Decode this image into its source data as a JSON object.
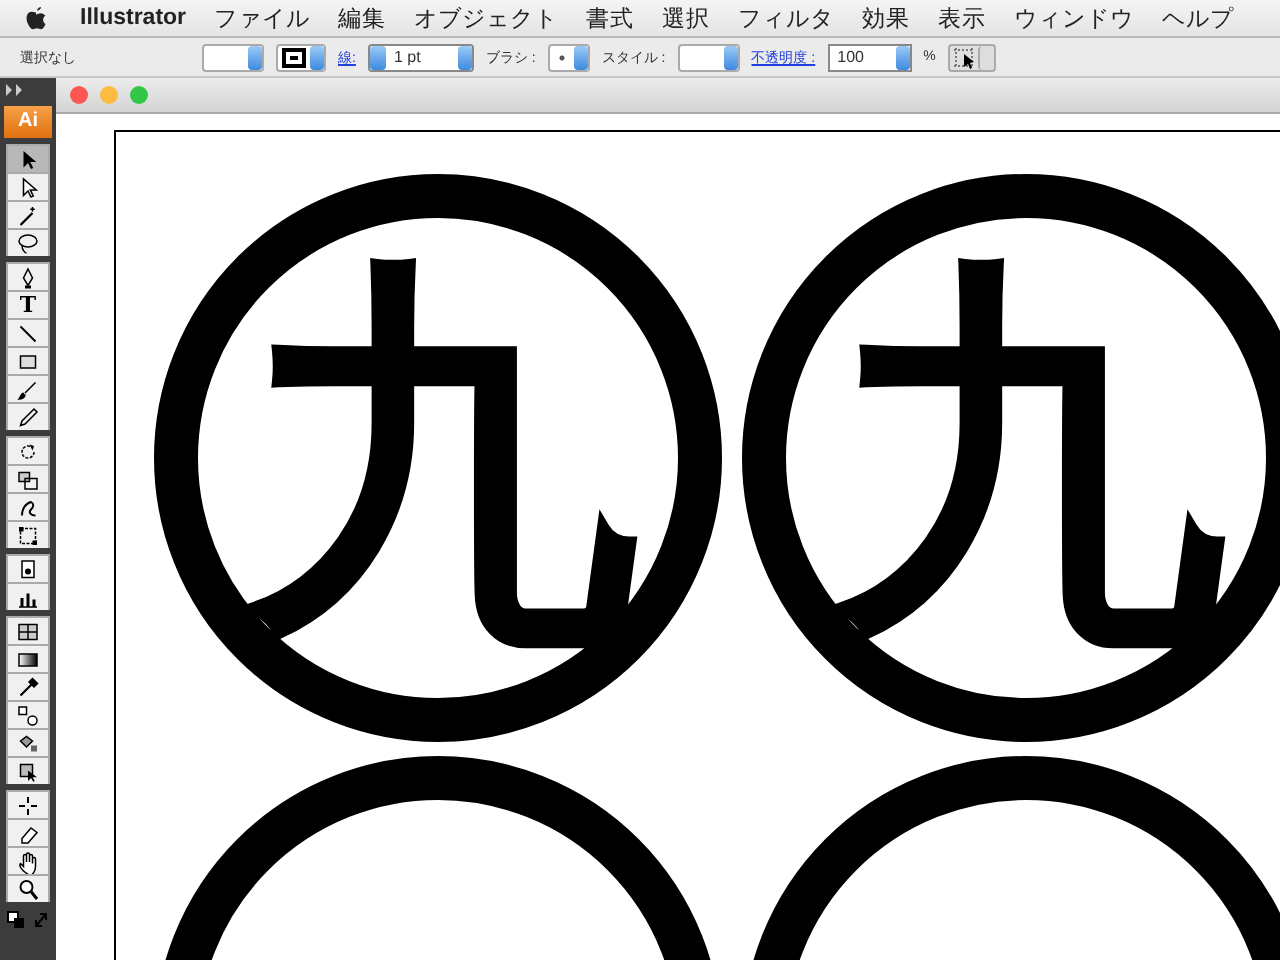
{
  "menu_bar": {
    "app": "Illustrator",
    "items": [
      "ファイル",
      "編集",
      "オブジェクト",
      "書式",
      "選択",
      "フィルタ",
      "効果",
      "表示",
      "ウィンドウ",
      "ヘルプ"
    ]
  },
  "control_bar": {
    "selection_status": "選択なし",
    "stroke_label": "線:",
    "stroke_weight": "1 pt",
    "brush_label": "ブラシ :",
    "style_label": "スタイル :",
    "opacity_label": "不透明度 :",
    "opacity": "100",
    "opacity_unit": "%"
  },
  "tools_panel": {
    "logo": "Ai",
    "tools": [
      {
        "kind": "selection",
        "selected": true
      },
      {
        "kind": "direct-selection",
        "selected": false
      },
      {
        "kind": "magic-wand",
        "selected": false
      },
      {
        "kind": "lasso",
        "selected": false
      },
      {
        "kind": "pen",
        "selected": false
      },
      {
        "kind": "type",
        "label": "T",
        "selected": false
      },
      {
        "kind": "line",
        "selected": false
      },
      {
        "kind": "rectangle",
        "selected": false
      },
      {
        "kind": "paintbrush",
        "selected": false
      },
      {
        "kind": "pencil",
        "selected": false
      },
      {
        "kind": "rotate",
        "selected": false
      },
      {
        "kind": "scale",
        "selected": false
      },
      {
        "kind": "warp",
        "selected": false
      },
      {
        "kind": "free-transform",
        "selected": false
      },
      {
        "kind": "symbol",
        "selected": false
      },
      {
        "kind": "graph",
        "selected": false
      },
      {
        "kind": "mesh",
        "selected": false
      },
      {
        "kind": "gradient",
        "selected": false
      },
      {
        "kind": "eyedropper",
        "selected": false
      },
      {
        "kind": "blend",
        "selected": false
      },
      {
        "kind": "live-paint",
        "selected": false
      },
      {
        "kind": "live-paint-select",
        "selected": false
      },
      {
        "kind": "slice",
        "selected": false
      },
      {
        "kind": "eraser",
        "selected": false
      },
      {
        "kind": "hand",
        "selected": false
      },
      {
        "kind": "zoom",
        "selected": false
      }
    ]
  },
  "document": {
    "crests": [
      {
        "kind": "full",
        "character": "九"
      },
      {
        "kind": "full",
        "character": "九"
      },
      {
        "kind": "cut"
      },
      {
        "kind": "cut"
      }
    ]
  }
}
